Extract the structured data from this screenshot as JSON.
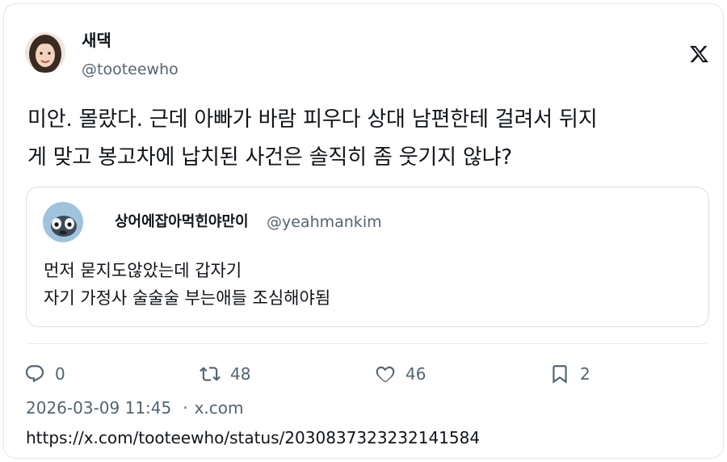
{
  "author": {
    "display_name": "새댁",
    "handle": "@tooteewho"
  },
  "logo_icon": "x-logo",
  "tweet": {
    "lines": [
      "미안. 몰랐다. 근데 아빠가 바람 피우다 상대 남편한테 걸려서 뒤지",
      "게 맞고 봉고차에 납치된 사건은 솔직히 좀 웃기지 않냐?"
    ]
  },
  "quote": {
    "display_name": "상어에잡아먹힌야만이",
    "handle": "@yeahmankim",
    "lines": [
      "먼저 묻지도않았는데 갑자기",
      "자기 가정사 술술술 부는애들 조심해야됨"
    ]
  },
  "actions": {
    "reply": {
      "icon": "reply-icon",
      "count": "0"
    },
    "retweet": {
      "icon": "retweet-icon",
      "count": "48"
    },
    "like": {
      "icon": "heart-icon",
      "count": "46"
    },
    "bookmark": {
      "icon": "bookmark-icon",
      "count": "2"
    }
  },
  "meta": {
    "timestamp": "2026-03-09 11:45",
    "separator": "·",
    "source": "x.com"
  },
  "url": "https://x.com/tooteewho/status/2030837323232141584",
  "colors": {
    "text": "#0f1419",
    "secondary": "#536471",
    "border": "#e1e8ed"
  }
}
